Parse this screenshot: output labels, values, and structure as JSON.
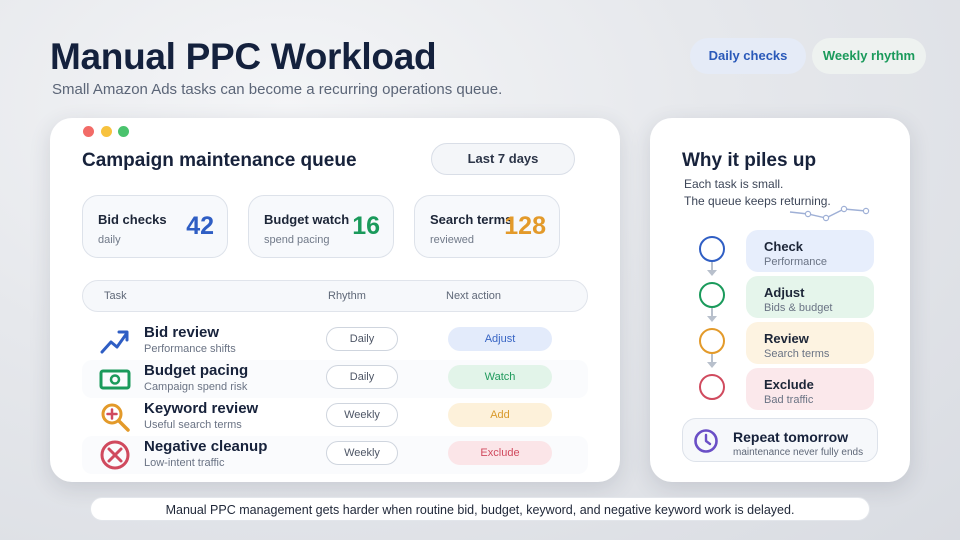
{
  "header": {
    "title": "Manual PPC Workload",
    "subtitle": "Small Amazon Ads tasks can become a recurring operations queue.",
    "pill_daily": "Daily checks",
    "pill_weekly": "Weekly rhythm"
  },
  "queue": {
    "title": "Campaign maintenance queue",
    "range_button": "Last 7 days",
    "stats": [
      {
        "label": "Bid checks",
        "sub": "daily",
        "value": "42",
        "color": "#2f5ec4"
      },
      {
        "label": "Budget watch",
        "sub": "spend pacing",
        "value": "16",
        "color": "#1a9a5b"
      },
      {
        "label": "Search terms",
        "sub": "reviewed",
        "value": "128",
        "color": "#e39a2a"
      }
    ],
    "columns": {
      "task": "Task",
      "rhythm": "Rhythm",
      "next_action": "Next action"
    },
    "rows": [
      {
        "title": "Bid review",
        "sub": "Performance shifts",
        "rhythm": "Daily",
        "action": "Adjust",
        "icon": "trend-up-icon",
        "action_bg": "#e3ebfb",
        "action_fg": "#3764c4"
      },
      {
        "title": "Budget pacing",
        "sub": "Campaign spend risk",
        "rhythm": "Daily",
        "action": "Watch",
        "icon": "money-icon",
        "action_bg": "#e2f4e9",
        "action_fg": "#1f9a5c"
      },
      {
        "title": "Keyword review",
        "sub": "Useful search terms",
        "rhythm": "Weekly",
        "action": "Add",
        "icon": "magnifier-plus-icon",
        "action_bg": "#fdf1da",
        "action_fg": "#d99a2c"
      },
      {
        "title": "Negative cleanup",
        "sub": "Low-intent traffic",
        "rhythm": "Weekly",
        "action": "Exclude",
        "icon": "cancel-circle-icon",
        "action_bg": "#fbe5e8",
        "action_fg": "#d04a5e"
      }
    ]
  },
  "side": {
    "title": "Why it piles up",
    "line1": "Each task is small.",
    "line2": "The queue keeps returning.",
    "steps": [
      {
        "title": "Check",
        "sub": "Performance",
        "ring": "#2f5ec4",
        "bg": "#e7eefc"
      },
      {
        "title": "Adjust",
        "sub": "Bids & budget",
        "ring": "#1a9a5b",
        "bg": "#e5f5eb"
      },
      {
        "title": "Review",
        "sub": "Search terms",
        "ring": "#e39a2a",
        "bg": "#fdf3e1"
      },
      {
        "title": "Exclude",
        "sub": "Bad traffic",
        "ring": "#d04a5e",
        "bg": "#fbe8eb"
      }
    ],
    "repeat_title": "Repeat tomorrow",
    "repeat_sub": "maintenance never fully ends"
  },
  "footer": "Manual PPC management gets harder when routine bid, budget, keyword, and negative keyword work is delayed."
}
